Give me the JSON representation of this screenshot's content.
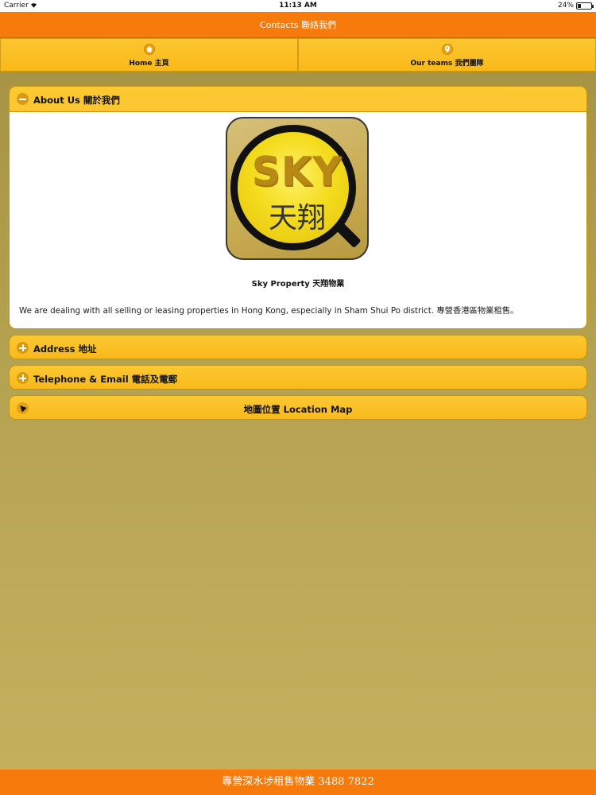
{
  "status_bar": {
    "carrier": "Carrier",
    "time": "11:13 AM",
    "battery": "24%",
    "battery_level": 0.24
  },
  "header": {
    "title": "Contacts 聯絡我們"
  },
  "nav": {
    "home_label": "Home 主頁",
    "home_icon": "home-icon",
    "teams_label": "Our teams 我們團隊",
    "teams_icon": "location-pin-icon"
  },
  "about": {
    "title": "About Us 關於我們",
    "logo": {
      "brand_en": "SKY",
      "brand_zh": "天翔"
    },
    "caption": "Sky Property 天翔物業",
    "description": "We are dealing with all selling or leasing properties in Hong Kong, especially in Sham Shui Po district. 專營香港區物業租售。"
  },
  "address": {
    "title": "Address 地址"
  },
  "telephone": {
    "title": "Telephone & Email 電話及電郵"
  },
  "map": {
    "title": "地圖位置 Location Map"
  },
  "footer": {
    "text": "專營深水埗租售物業 3488 7822"
  },
  "colors": {
    "orange": "#f77b0c",
    "yellow": "#fbbd22",
    "background": "#b5a250"
  }
}
